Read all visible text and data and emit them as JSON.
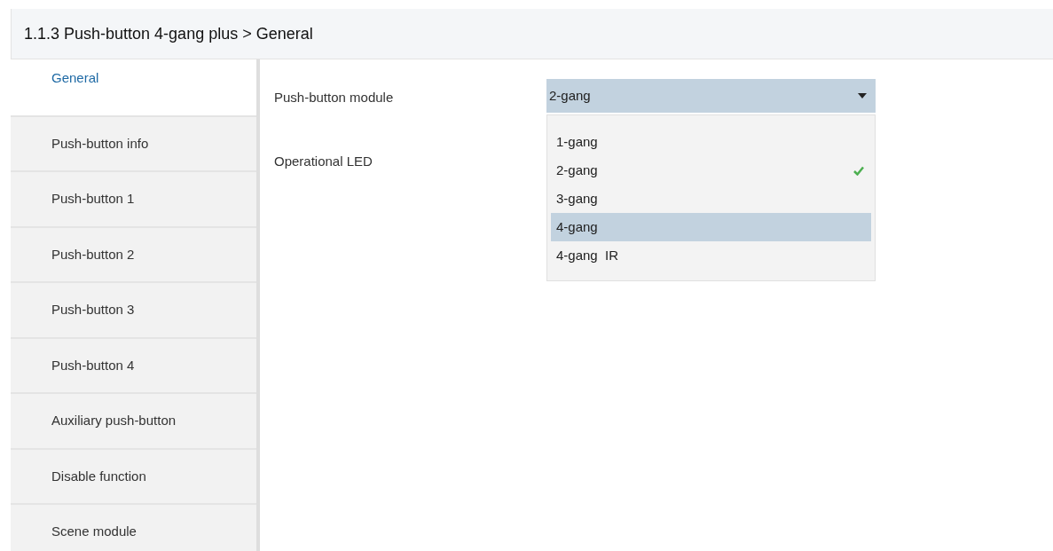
{
  "header": {
    "title": "1.1.3 Push-button 4-gang plus > General"
  },
  "sidebar": {
    "items": [
      {
        "label": "General",
        "selected": true
      },
      {
        "label": "Push-button info",
        "selected": false
      },
      {
        "label": "Push-button 1",
        "selected": false
      },
      {
        "label": "Push-button 2",
        "selected": false
      },
      {
        "label": "Push-button 3",
        "selected": false
      },
      {
        "label": "Push-button 4",
        "selected": false
      },
      {
        "label": "Auxiliary push-button",
        "selected": false
      },
      {
        "label": "Disable function",
        "selected": false
      },
      {
        "label": "Scene module",
        "selected": false
      }
    ]
  },
  "parameters": [
    {
      "label": "Push-button module",
      "value": "2-gang",
      "expanded": true,
      "options": [
        {
          "label": "1-gang",
          "selected": false,
          "highlighted": false
        },
        {
          "label": "2-gang",
          "selected": true,
          "highlighted": false
        },
        {
          "label": "3-gang",
          "selected": false,
          "highlighted": false
        },
        {
          "label": "4-gang",
          "selected": false,
          "highlighted": true
        },
        {
          "label": "4-gang  IR",
          "selected": false,
          "highlighted": false
        }
      ]
    },
    {
      "label": "Operational LED"
    }
  ]
}
